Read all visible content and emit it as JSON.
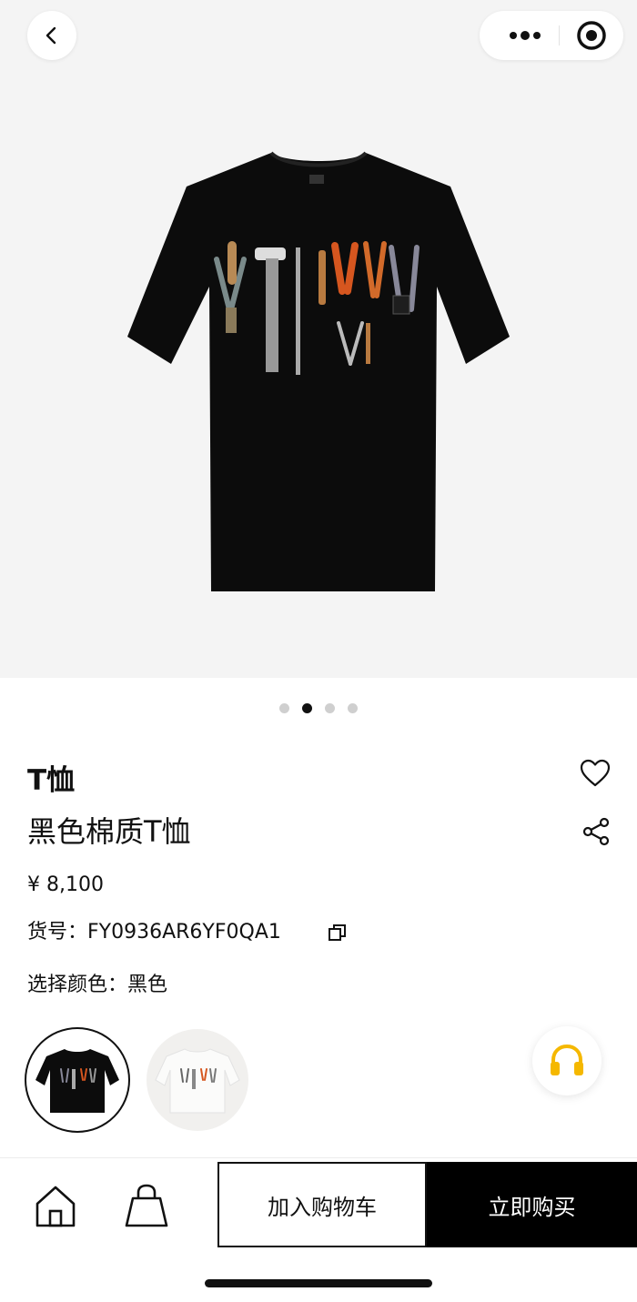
{
  "product": {
    "category_title": "T恤",
    "name": "黑色棉质T恤",
    "price": "¥ 8,100",
    "sku_label": "货号：",
    "sku": "FY0936AR6YF0QA1",
    "color_label": "选择颜色：",
    "color_value": "黑色",
    "colors": [
      "black",
      "white"
    ]
  },
  "gallery": {
    "total": 4,
    "active_index": 1
  },
  "actions": {
    "add_to_cart": "加入购物车",
    "buy_now": "立即购买"
  },
  "icons": [
    "back-icon",
    "more-icon",
    "target-icon",
    "heart-icon",
    "share-icon",
    "copy-icon",
    "headset-icon",
    "home-icon",
    "bag-icon"
  ],
  "colors": {
    "background": "#ffffff",
    "hero_bg": "#f4f4f4",
    "primary": "#000000",
    "accent_service": "#f5b800"
  }
}
